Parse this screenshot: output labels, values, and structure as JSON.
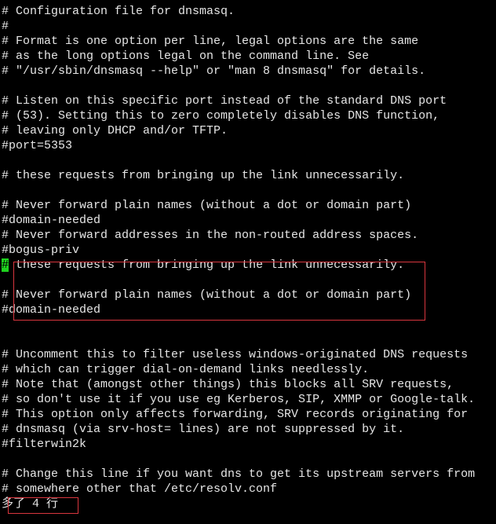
{
  "editor": {
    "lines": [
      "# Configuration file for dnsmasq.",
      "#",
      "# Format is one option per line, legal options are the same",
      "# as the long options legal on the command line. See",
      "# \"/usr/sbin/dnsmasq --help\" or \"man 8 dnsmasq\" for details.",
      "",
      "# Listen on this specific port instead of the standard DNS port",
      "# (53). Setting this to zero completely disables DNS function,",
      "# leaving only DHCP and/or TFTP.",
      "#port=5353",
      "",
      "# these requests from bringing up the link unnecessarily.",
      "",
      "# Never forward plain names (without a dot or domain part)",
      "#domain-needed",
      "# Never forward addresses in the non-routed address spaces.",
      "#bogus-priv",
      "# these requests from bringing up the link unnecessarily.",
      "",
      "# Never forward plain names (without a dot or domain part)",
      "#domain-needed",
      "",
      "",
      "# Uncomment this to filter useless windows-originated DNS requests",
      "# which can trigger dial-on-demand links needlessly.",
      "# Note that (amongst other things) this blocks all SRV requests,",
      "# so don't use it if you use eg Kerberos, SIP, XMMP or Google-talk.",
      "# This option only affects forwarding, SRV records originating for",
      "# dnsmasq (via srv-host= lines) are not suppressed by it.",
      "#filterwin2k",
      "",
      "# Change this line if you want dns to get its upstream servers from",
      "# somewhere other that /etc/resolv.conf"
    ],
    "cursor_line": 17,
    "cursor_char": "#",
    "cursor_rest": " these requests from bringing up the link unnecessarily.",
    "status_message": "多了 4 行"
  },
  "colors": {
    "background": "#000000",
    "text": "#e6e6e6",
    "cursor": "#1fd21f",
    "highlight_box": "#d9363e"
  }
}
